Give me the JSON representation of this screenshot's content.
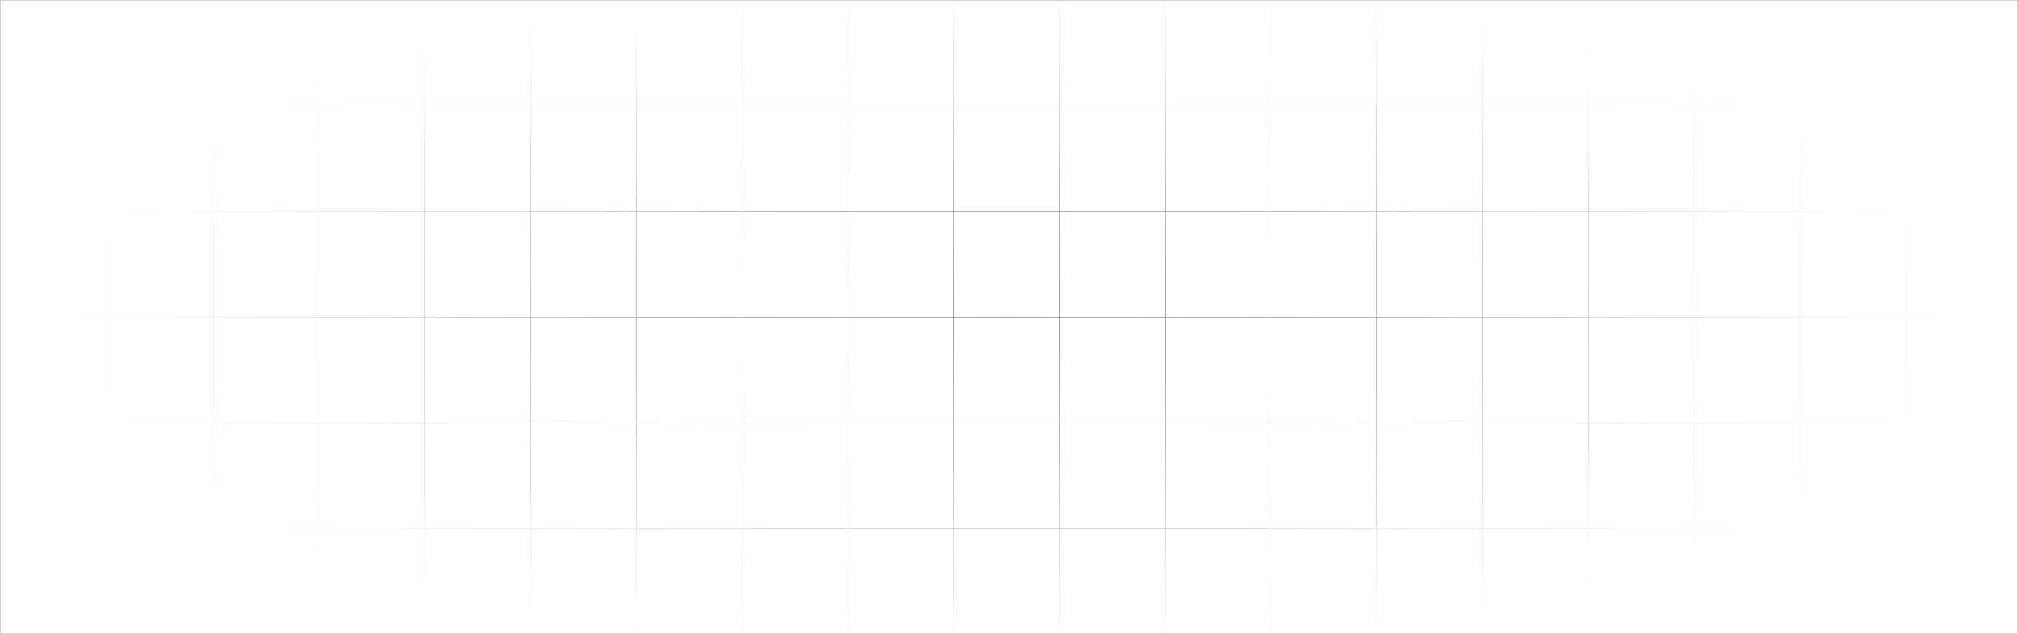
{
  "background": {
    "color": "#ffffff",
    "border_color": "#cfcfcf",
    "grid_color": "#9e9e9e"
  }
}
